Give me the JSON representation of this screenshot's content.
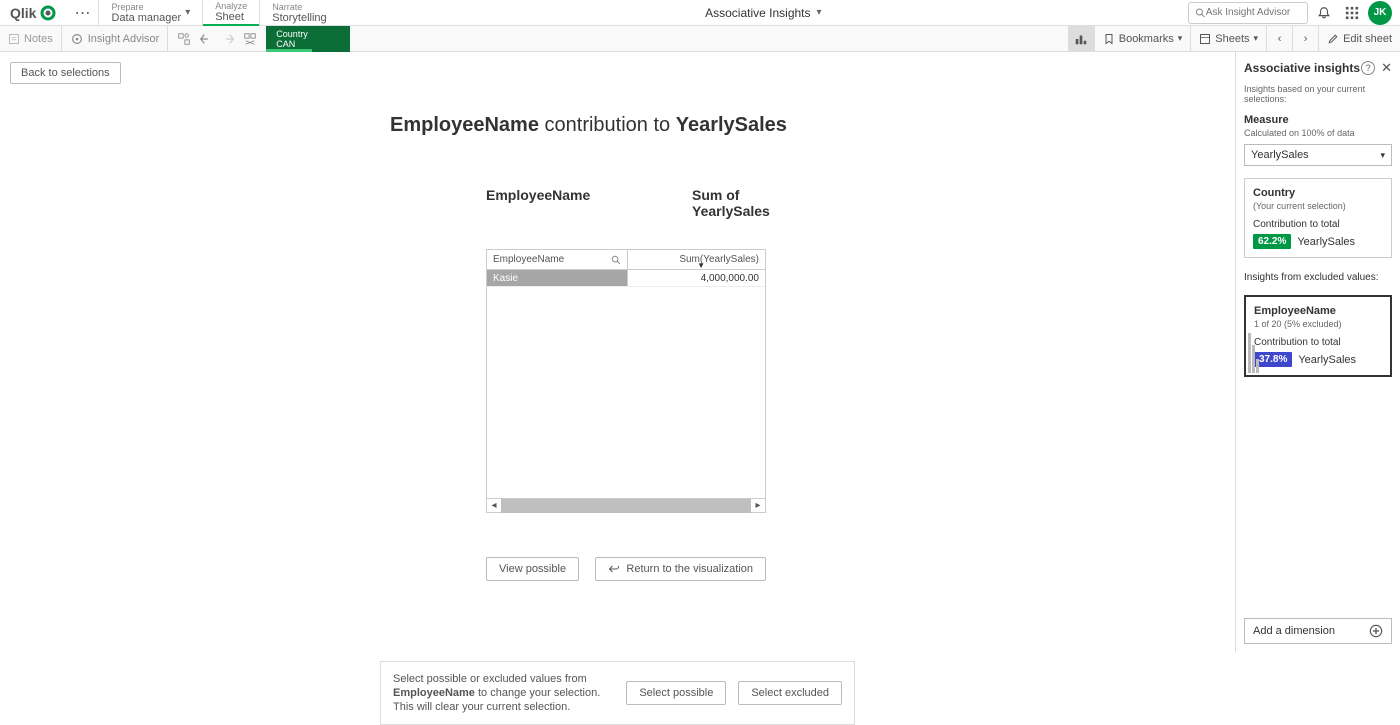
{
  "topbar": {
    "logo_text": "Qlik",
    "nav": {
      "prepare_small": "Prepare",
      "prepare_big": "Data manager",
      "analyze_small": "Analyze",
      "analyze_big": "Sheet",
      "narrate_small": "Narrate",
      "narrate_big": "Storytelling"
    },
    "app_title": "Associative Insights",
    "search_placeholder": "Ask Insight Advisor",
    "avatar_initials": "JK"
  },
  "secondbar": {
    "notes": "Notes",
    "advisor": "Insight Advisor",
    "selection": {
      "field": "Country",
      "value": "CAN"
    },
    "bookmarks": "Bookmarks",
    "sheets": "Sheets",
    "edit": "Edit sheet"
  },
  "page": {
    "back": "Back to selections",
    "title_field": "EmployeeName",
    "title_mid": " contribution to ",
    "title_measure": "YearlySales",
    "col1_header": "EmployeeName",
    "col2_header": "Sum of YearlySales",
    "table": {
      "head_name": "EmployeeName",
      "head_value": "Sum(YearlySales)",
      "rows": [
        {
          "name": "Kasie",
          "value": "4,000,000.00"
        }
      ]
    },
    "view_possible": "View possible",
    "return_viz": "Return to the visualization",
    "hint_pre": "Select possible or excluded values from ",
    "hint_field": "EmployeeName",
    "hint_post": " to change your selection. This will clear your current selection.",
    "select_possible": "Select possible",
    "select_excluded": "Select excluded"
  },
  "panel": {
    "title": "Associative insights",
    "based_on": "Insights based on your current selections:",
    "measure_lbl": "Measure",
    "calc_on": "Calculated on 100% of data",
    "measure_select": "YearlySales",
    "card1": {
      "name": "Country",
      "sub": "(Your current selection)",
      "contrib": "Contribution to total",
      "pct": "62.2%",
      "metric": "YearlySales"
    },
    "excluded_lbl": "Insights from excluded values:",
    "card2": {
      "name": "EmployeeName",
      "sub": "1 of 20 (5% excluded)",
      "contrib": "Contribution to total",
      "pct": "37.8%",
      "metric": "YearlySales"
    },
    "add_dim": "Add a dimension"
  }
}
